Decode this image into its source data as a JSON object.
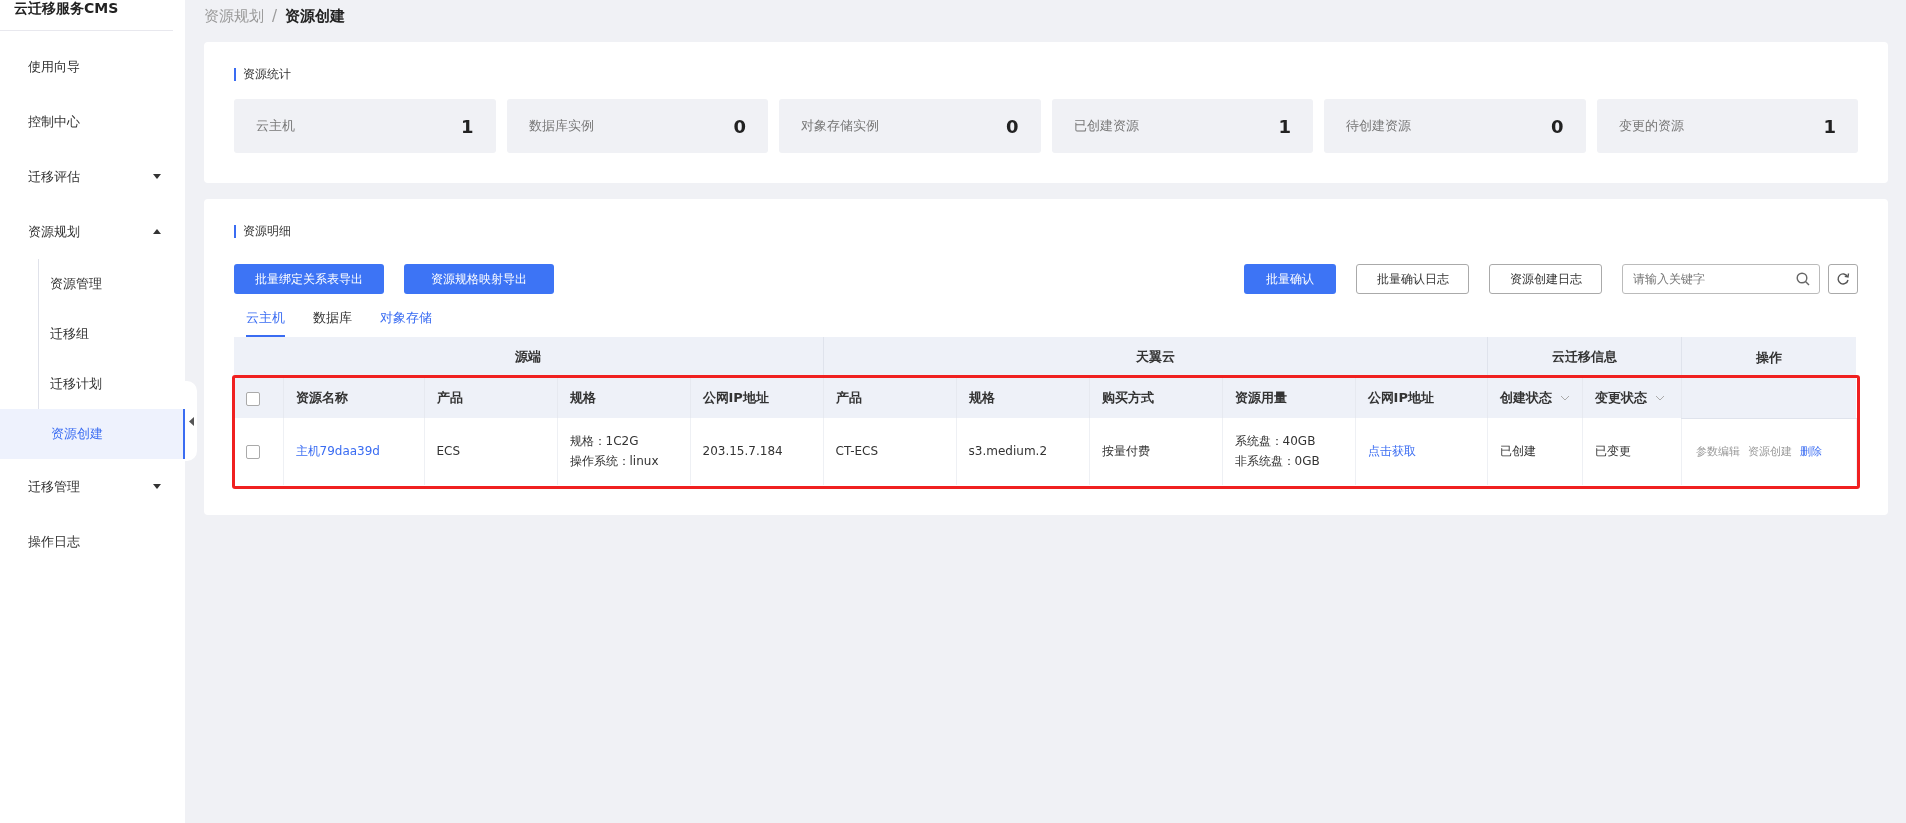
{
  "sidebar": {
    "title": "云迁移服务CMS",
    "items": [
      {
        "label": "使用向导",
        "selected": false
      },
      {
        "label": "控制中心",
        "selected": false
      },
      {
        "label": "迁移评估",
        "selected": false,
        "expanded": false
      },
      {
        "label": "资源规划",
        "selected": false,
        "expanded": true,
        "children": [
          {
            "label": "资源管理",
            "selected": false
          },
          {
            "label": "迁移组",
            "selected": false
          },
          {
            "label": "迁移计划",
            "selected": false
          },
          {
            "label": "资源创建",
            "selected": true
          }
        ]
      },
      {
        "label": "迁移管理",
        "selected": false,
        "expanded": false
      },
      {
        "label": "操作日志",
        "selected": false
      }
    ]
  },
  "breadcrumb": [
    "资源规划",
    "资源创建"
  ],
  "breadcrumb_separator": "/",
  "stats": {
    "title": "资源统计",
    "items": [
      {
        "label": "云主机",
        "value": "1"
      },
      {
        "label": "数据库实例",
        "value": "0"
      },
      {
        "label": "对象存储实例",
        "value": "0"
      },
      {
        "label": "已创建资源",
        "value": "1"
      },
      {
        "label": "待创建资源",
        "value": "0"
      },
      {
        "label": "变更的资源",
        "value": "1"
      }
    ]
  },
  "details": {
    "title": "资源明细",
    "left_buttons": [
      "批量绑定关系表导出",
      "资源规格映射导出"
    ],
    "right_buttons": [
      {
        "label": "批量确认",
        "kind": "primary"
      },
      {
        "label": "批量确认日志",
        "kind": "outline"
      },
      {
        "label": "资源创建日志",
        "kind": "outline"
      }
    ],
    "search": {
      "placeholder": "请输入关键字"
    },
    "tabs": [
      {
        "label": "云主机",
        "selected": true,
        "hovered": false
      },
      {
        "label": "数据库",
        "selected": false,
        "hovered": false
      },
      {
        "label": "对象存储",
        "selected": false,
        "hovered": true
      }
    ],
    "table": {
      "highlighted": true,
      "groups": [
        {
          "label": "源端"
        },
        {
          "label": "天翼云"
        },
        {
          "label": "云迁移信息"
        }
      ],
      "actions_header": "操作",
      "columns": [
        {
          "label": "资源名称"
        },
        {
          "label": "产品"
        },
        {
          "label": "规格"
        },
        {
          "label": "公网IP地址"
        },
        {
          "label": "产品"
        },
        {
          "label": "规格"
        },
        {
          "label": "购买方式"
        },
        {
          "label": "资源用量"
        },
        {
          "label": "公网IP地址"
        },
        {
          "label": "创建状态",
          "filter": true
        },
        {
          "label": "变更状态",
          "filter": true
        }
      ],
      "all_checked": false,
      "rows": [
        {
          "checked": false,
          "cells": [
            {
              "lines": [
                "主机79daa39d"
              ],
              "kind": "link"
            },
            {
              "lines": [
                "ECS"
              ],
              "kind": "text"
            },
            {
              "lines": [
                "规格：1C2G",
                "操作系统：linux"
              ],
              "kind": "text"
            },
            {
              "lines": [
                "203.15.7.184"
              ],
              "kind": "text"
            },
            {
              "lines": [
                "CT-ECS"
              ],
              "kind": "text"
            },
            {
              "lines": [
                "s3.medium.2"
              ],
              "kind": "text"
            },
            {
              "lines": [
                "按量付费"
              ],
              "kind": "text"
            },
            {
              "lines": [
                "系统盘：40GB",
                "非系统盘：0GB"
              ],
              "kind": "text"
            },
            {
              "lines": [
                "点击获取"
              ],
              "kind": "link"
            },
            {
              "lines": [
                "已创建"
              ],
              "kind": "text"
            },
            {
              "lines": [
                "已变更"
              ],
              "kind": "text"
            }
          ],
          "actions": [
            {
              "label": "参数编辑",
              "disabled": true
            },
            {
              "label": "资源创建",
              "disabled": true
            },
            {
              "label": "删除",
              "disabled": false
            }
          ]
        }
      ]
    }
  }
}
